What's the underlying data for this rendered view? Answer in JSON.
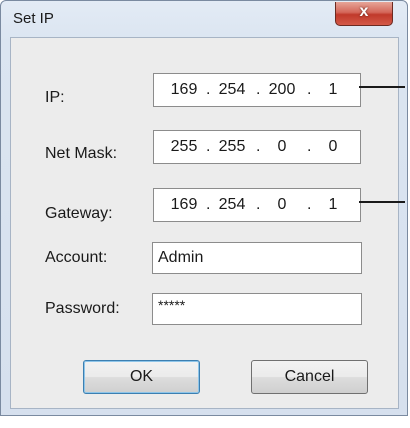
{
  "window": {
    "title": "Set IP",
    "close_glyph": "x"
  },
  "fields": {
    "ip": {
      "label": "IP:",
      "octets": [
        "169",
        "254",
        "200",
        "1"
      ]
    },
    "net_mask": {
      "label": "Net Mask:",
      "octets": [
        "255",
        "255",
        "0",
        "0"
      ]
    },
    "gateway": {
      "label": "Gateway:",
      "octets": [
        "169",
        "254",
        "0",
        "1"
      ]
    },
    "account": {
      "label": "Account:",
      "value": "Admin"
    },
    "password": {
      "label": "Password:",
      "value": "*****"
    }
  },
  "buttons": {
    "ok": "OK",
    "cancel": "Cancel"
  },
  "dot": "."
}
